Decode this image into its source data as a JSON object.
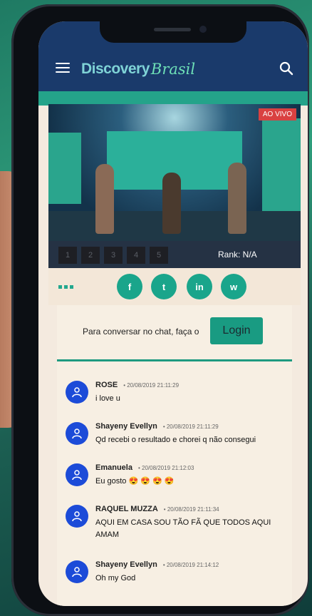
{
  "header": {
    "logo_main": "Discovery",
    "logo_sub": "Brasil"
  },
  "video": {
    "live_badge": "AO VIVO"
  },
  "rating": {
    "options": [
      "1",
      "2",
      "3",
      "4",
      "5"
    ],
    "rank_text": "Rank: N/A"
  },
  "share": {
    "buttons": [
      {
        "label": "f",
        "icon": "facebook-icon"
      },
      {
        "label": "t",
        "icon": "twitter-icon"
      },
      {
        "label": "in",
        "icon": "linkedin-icon"
      },
      {
        "label": "w",
        "icon": "whatsapp-icon"
      }
    ]
  },
  "chat": {
    "login_prompt": "Para conversar no chat, faça o",
    "login_button": "Login",
    "messages": [
      {
        "user": "ROSE",
        "time": "• 20/08/2019 21:11:29",
        "text": "i love u"
      },
      {
        "user": "Shayeny Evellyn",
        "time": "• 20/08/2019 21:11:29",
        "text": "Qd recebi o resultado e chorei q não consegui"
      },
      {
        "user": "Emanuela",
        "time": "• 20/08/2019 21:12:03",
        "text": "Eu gosto 😍 😍 😍 😍"
      },
      {
        "user": "RAQUEL MUZZA",
        "time": "• 20/08/2019 21:11:34",
        "text": "AQUI EM CASA SOU TÃO FÃ QUE TODOS AQUI AMAM"
      },
      {
        "user": "Shayeny Evellyn",
        "time": "• 20/08/2019 21:14:12",
        "text": "Oh my God"
      }
    ]
  }
}
